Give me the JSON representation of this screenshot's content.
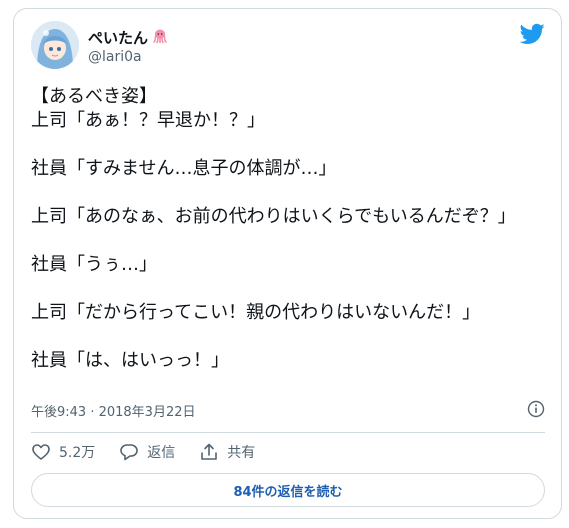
{
  "tweet": {
    "display_name": "ぺいたん",
    "name_emoji_icon": "octopus-emoji-icon",
    "handle": "@lari0a",
    "text": "【あるべき姿】\n上司「あぁ！？早退か！？」\n\n社員「すみません…息子の体調が…」\n\n上司「あのなぁ、お前の代わりはいくらでもいるんだぞ？」\n\n社員「うぅ…」\n\n上司「だから行ってこい！親の代わりはいないんだ！」\n\n社員「は、はいっっ！」",
    "timestamp": "午後9:43 · 2018年3月22日"
  },
  "actions": {
    "like_count": "5.2万",
    "reply_label": "返信",
    "share_label": "共有"
  },
  "read_replies_label": "84件の返信を読む",
  "colors": {
    "brand_blue": "#1d9bf0",
    "link_blue": "#1d5fb0",
    "text": "#0f1419",
    "muted": "#536471",
    "border": "#cfd9de"
  }
}
